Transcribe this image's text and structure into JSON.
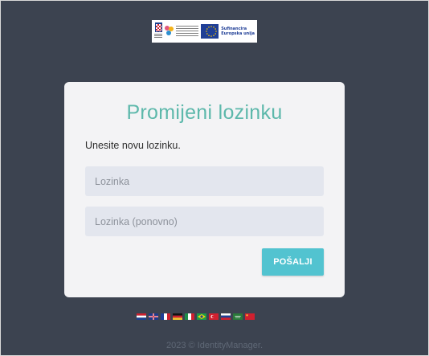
{
  "banner": {
    "funding_line1": "Sufinancira",
    "funding_line2": "Europska unija",
    "colors": {
      "eu_blue": "#1f3e96",
      "eu_star": "#ffcc00"
    }
  },
  "form": {
    "title": "Promijeni lozinku",
    "subtitle": "Unesite novu lozinku.",
    "password_placeholder": "Lozinka",
    "password_value": "",
    "password_repeat_placeholder": "Lozinka (ponovno)",
    "password_repeat_value": "",
    "submit_label": "POŠALJI"
  },
  "languages": [
    {
      "icon": "croatian-flag-icon",
      "colors": [
        "#d0202f",
        "#ffffff",
        "#1b3f8f"
      ],
      "orientation": "h"
    },
    {
      "icon": "english-flag-icon",
      "colors": [
        "#1f3a8a",
        "#ffffff",
        "#c8102e"
      ],
      "orientation": "uk"
    },
    {
      "icon": "french-flag-icon",
      "colors": [
        "#1f3e96",
        "#ffffff",
        "#d0202f"
      ],
      "orientation": "v"
    },
    {
      "icon": "german-flag-icon",
      "colors": [
        "#111111",
        "#d0202f",
        "#f2c230"
      ],
      "orientation": "h"
    },
    {
      "icon": "italian-flag-icon",
      "colors": [
        "#1d8f48",
        "#ffffff",
        "#d0202f"
      ],
      "orientation": "v"
    },
    {
      "icon": "portuguese-brazil-flag-icon",
      "colors": [
        "#1d9b48",
        "#f5d90a",
        "#1f3e96"
      ],
      "orientation": "br"
    },
    {
      "icon": "turkish-flag-icon",
      "colors": [
        "#d0202f",
        "#ffffff",
        "#d0202f"
      ],
      "orientation": "tr"
    },
    {
      "icon": "russian-flag-icon",
      "colors": [
        "#ffffff",
        "#1f3e96",
        "#d0202f"
      ],
      "orientation": "h"
    },
    {
      "icon": "arabic-flag-icon",
      "colors": [
        "#2a7a3a",
        "#2a7a3a",
        "#2a7a3a"
      ],
      "orientation": "sa"
    },
    {
      "icon": "chinese-flag-icon",
      "colors": [
        "#d0202f",
        "#d0202f",
        "#f2c230"
      ],
      "orientation": "cn"
    }
  ],
  "footer": {
    "text": "2023 © IdentityManager."
  },
  "colors": {
    "background": "#3c4350",
    "card": "#f3f3f5",
    "title": "#5db8ab",
    "button": "#52c3d0",
    "field": "#e3e6ee",
    "footer_text": "#5f6876"
  }
}
